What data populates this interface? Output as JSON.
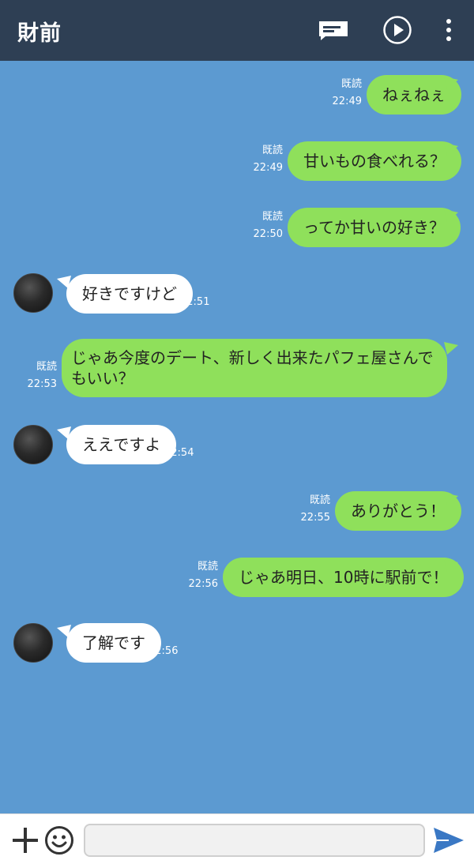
{
  "header": {
    "title": "財前"
  },
  "messages": [
    {
      "side": "out",
      "text": "ねぇねぇ",
      "read": "既読",
      "time": "22:49"
    },
    {
      "side": "out",
      "text": "甘いもの食べれる？",
      "read": "既読",
      "time": "22:49"
    },
    {
      "side": "out",
      "text": "ってか甘いの好き？",
      "read": "既読",
      "time": "22:50"
    },
    {
      "side": "in",
      "text": "好きですけど",
      "time": "22:51"
    },
    {
      "side": "out",
      "text": "じゃあ今度のデート、新しく出来たパフェ屋さんでもいい？",
      "read": "既読",
      "time": "22:53"
    },
    {
      "side": "in",
      "text": "ええですよ",
      "time": "22:54"
    },
    {
      "side": "out",
      "text": "ありがとう！",
      "read": "既読",
      "time": "22:55"
    },
    {
      "side": "out",
      "text": "じゃあ明日、10時に駅前で！",
      "read": "既読",
      "time": "22:56"
    },
    {
      "side": "in",
      "text": "了解です",
      "time": "22:56"
    }
  ],
  "footer": {
    "input_value": "",
    "input_placeholder": ""
  },
  "colors": {
    "background": "#5c9ad1",
    "header": "#2e3f54",
    "outgoing_bubble": "#8fe05b",
    "incoming_bubble": "#ffffff",
    "send_accent": "#3a78c4"
  },
  "icons": {
    "note": "note-icon",
    "play": "play-icon",
    "menu": "more-vertical-icon",
    "plus": "plus-icon",
    "emoji": "emoji-icon",
    "send": "send-icon"
  }
}
